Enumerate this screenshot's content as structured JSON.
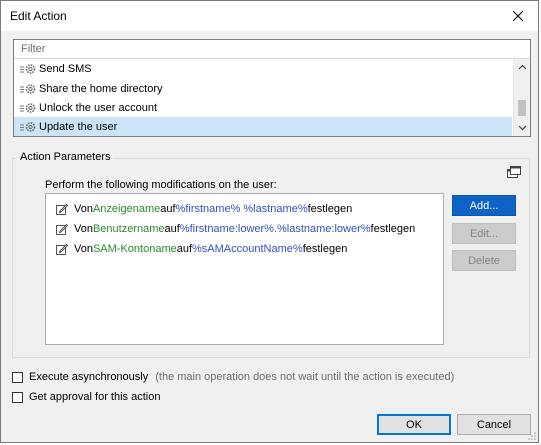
{
  "window": {
    "title": "Edit Action",
    "close_icon": "close-icon"
  },
  "action_list": {
    "filter_placeholder": "Filter",
    "items": [
      {
        "label": "Send SMS",
        "icon": "gear-icon",
        "selected": false
      },
      {
        "label": "Share the home directory",
        "icon": "gear-icon",
        "selected": false
      },
      {
        "label": "Unlock the user account",
        "icon": "gear-icon",
        "selected": false
      },
      {
        "label": "Update the user",
        "icon": "gear-icon",
        "selected": true
      }
    ]
  },
  "parameters": {
    "group_title": "Action Parameters",
    "perform_label": "Perform the following modifications on the user:",
    "modifications": [
      {
        "prefix": "Von ",
        "attribute": "Anzeigename",
        "mid": " auf ",
        "value": "%firstname% %lastname%",
        "suffix": " festlegen"
      },
      {
        "prefix": "Von ",
        "attribute": "Benutzername",
        "mid": " auf ",
        "value": "%firstname:lower%.%lastname:lower%",
        "suffix": " festlegen"
      },
      {
        "prefix": "Von ",
        "attribute": "SAM-Kontoname",
        "mid": " auf ",
        "value": "%sAMAccountName%",
        "suffix": " festlegen"
      }
    ],
    "buttons": {
      "add": "Add...",
      "edit": "Edit...",
      "delete": "Delete"
    }
  },
  "options": {
    "async_label": "Execute asynchronously",
    "async_hint": "(the main operation does not wait until the action is executed)",
    "async_checked": false,
    "approval_label": "Get approval for this action",
    "approval_checked": false
  },
  "footer": {
    "ok": "OK",
    "cancel": "Cancel"
  },
  "colors": {
    "selected_bg": "#cce4f7",
    "primary_button": "#0f63c7",
    "attribute_text": "#2c8a2c",
    "value_text": "#3050c8"
  }
}
